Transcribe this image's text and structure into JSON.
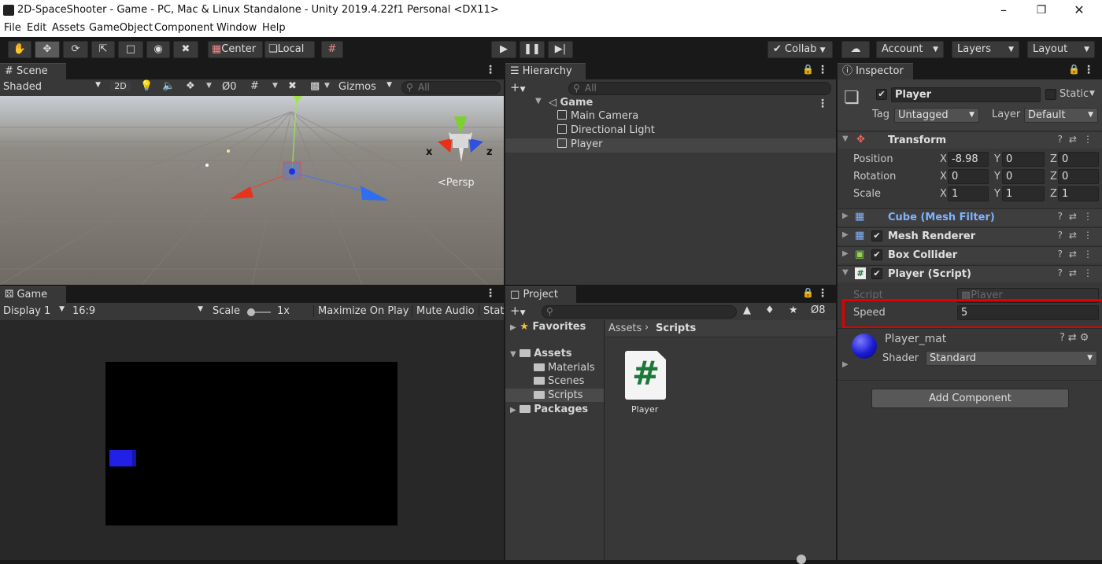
{
  "window": {
    "title": "2D-SpaceShooter - Game - PC, Mac & Linux Standalone - Unity 2019.4.22f1 Personal <DX11>"
  },
  "menu": [
    "File",
    "Edit",
    "Assets",
    "GameObject",
    "Component",
    "Window",
    "Help"
  ],
  "toolbar": {
    "center_label": "Center",
    "local_label": "Local",
    "collab_label": "Collab",
    "account_label": "Account",
    "layers_label": "Layers",
    "layout_label": "Layout"
  },
  "scene": {
    "tab": "Scene",
    "shading": "Shaded",
    "mode_2d": "2D",
    "hidden_count": "0",
    "gizmos": "Gizmos",
    "search_placeholder": "All",
    "persp": "Persp",
    "axis_x": "x",
    "axis_z": "z"
  },
  "game": {
    "tab": "Game",
    "display": "Display 1",
    "aspect": "16:9",
    "scale_label": "Scale",
    "scale_value": "1x",
    "maximize": "Maximize On Play",
    "mute": "Mute Audio",
    "stats": "Stat"
  },
  "hierarchy": {
    "tab": "Hierarchy",
    "search_placeholder": "All",
    "scene": "Game",
    "items": [
      "Main Camera",
      "Directional Light",
      "Player"
    ]
  },
  "project": {
    "tab": "Project",
    "hidden_count": "8",
    "favorites": "Favorites",
    "assets": "Assets",
    "folders": [
      "Materials",
      "Scenes",
      "Scripts"
    ],
    "packages": "Packages",
    "breadcrumb": [
      "Assets",
      "Scripts"
    ],
    "file": "Player"
  },
  "inspector": {
    "tab": "Inspector",
    "object_name": "Player",
    "static_label": "Static",
    "tag_label": "Tag",
    "tag_value": "Untagged",
    "layer_label": "Layer",
    "layer_value": "Default",
    "transform": {
      "title": "Transform",
      "position_label": "Position",
      "rotation_label": "Rotation",
      "scale_label": "Scale",
      "position": {
        "x": "-8.98",
        "y": "0",
        "z": "0"
      },
      "rotation": {
        "x": "0",
        "y": "0",
        "z": "0"
      },
      "scale": {
        "x": "1",
        "y": "1",
        "z": "1"
      }
    },
    "components": [
      "Cube (Mesh Filter)",
      "Mesh Renderer",
      "Box Collider",
      "Player (Script)"
    ],
    "script_label": "Script",
    "script_value": "Player",
    "speed_label": "Speed",
    "speed_value": "5",
    "material_name": "Player_mat",
    "shader_label": "Shader",
    "shader_value": "Standard",
    "add_component": "Add Component",
    "axis_x": "X",
    "axis_y": "Y",
    "axis_z": "Z"
  },
  "colors": {
    "highlight": "#e00000",
    "panel": "#383838",
    "dark": "#191919",
    "mesh_filter_blue": "#7fb3ff",
    "player_cube": "#2020e6"
  }
}
